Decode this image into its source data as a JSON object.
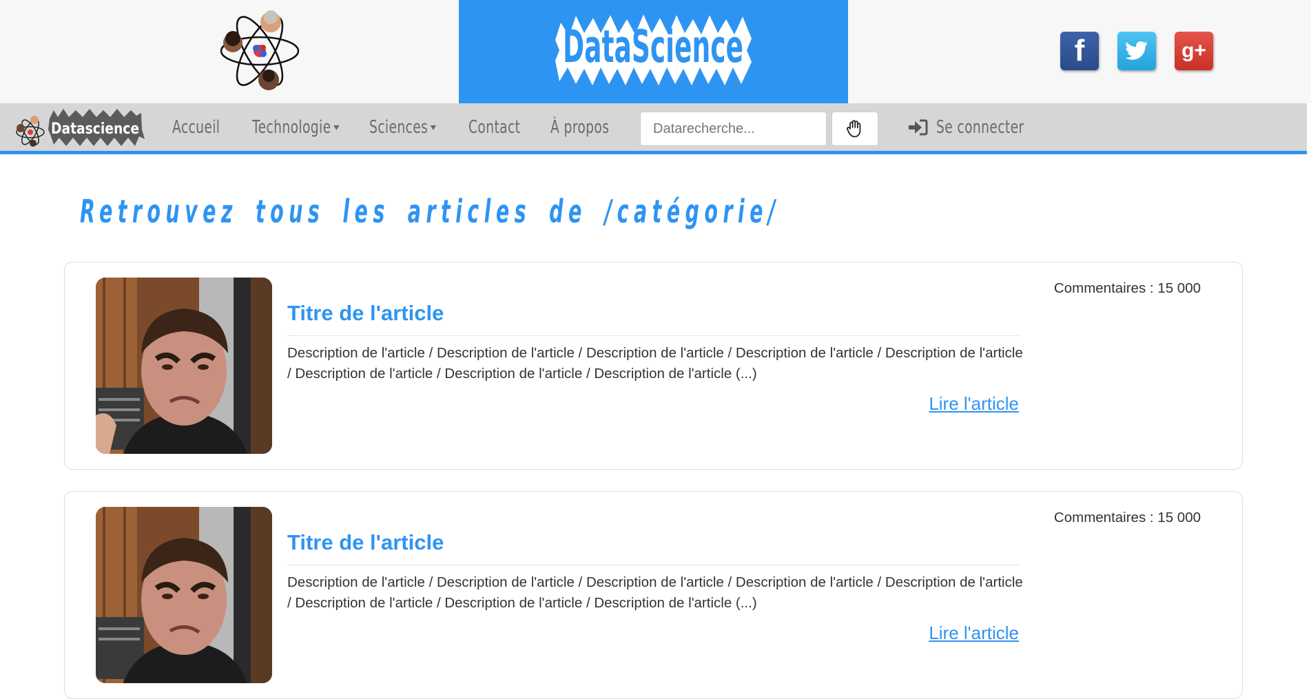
{
  "header": {
    "brand_text": "DataScience",
    "social": [
      {
        "name": "facebook",
        "glyph": "f"
      },
      {
        "name": "twitter",
        "glyph": "bird"
      },
      {
        "name": "google-plus",
        "glyph": "g+"
      }
    ]
  },
  "navbar": {
    "logo_text": "Datascience",
    "items": [
      {
        "label": "Accueil",
        "dropdown": false
      },
      {
        "label": "Technologie",
        "dropdown": true
      },
      {
        "label": "Sciences",
        "dropdown": true
      },
      {
        "label": "Contact",
        "dropdown": false
      },
      {
        "label": "À propos",
        "dropdown": false
      }
    ],
    "search_placeholder": "Datarecherche...",
    "search_icon": "hand-icon",
    "login_label": "Se connecter",
    "login_icon": "sign-in-icon"
  },
  "page": {
    "heading": "Retrouvez tous les articles de /catégorie/"
  },
  "articles": [
    {
      "title": "Titre de l'article",
      "description": "Description de l'article / Description de l'article / Description de l'article / Description de l'article / Description de l'article / Description de l'article / Description de l'article / Description de l'article (...)",
      "link_label": "Lire l'article",
      "comments": "Commentaires : 15 000"
    },
    {
      "title": "Titre de l'article",
      "description": "Description de l'article / Description de l'article / Description de l'article / Description de l'article / Description de l'article / Description de l'article / Description de l'article / Description de l'article (...)",
      "link_label": "Lire l'article",
      "comments": "Commentaires : 15 000"
    }
  ],
  "colors": {
    "accent": "#2e94f2",
    "navbar_bg": "#d6d6d6",
    "header_bg": "#f7f7f7"
  }
}
